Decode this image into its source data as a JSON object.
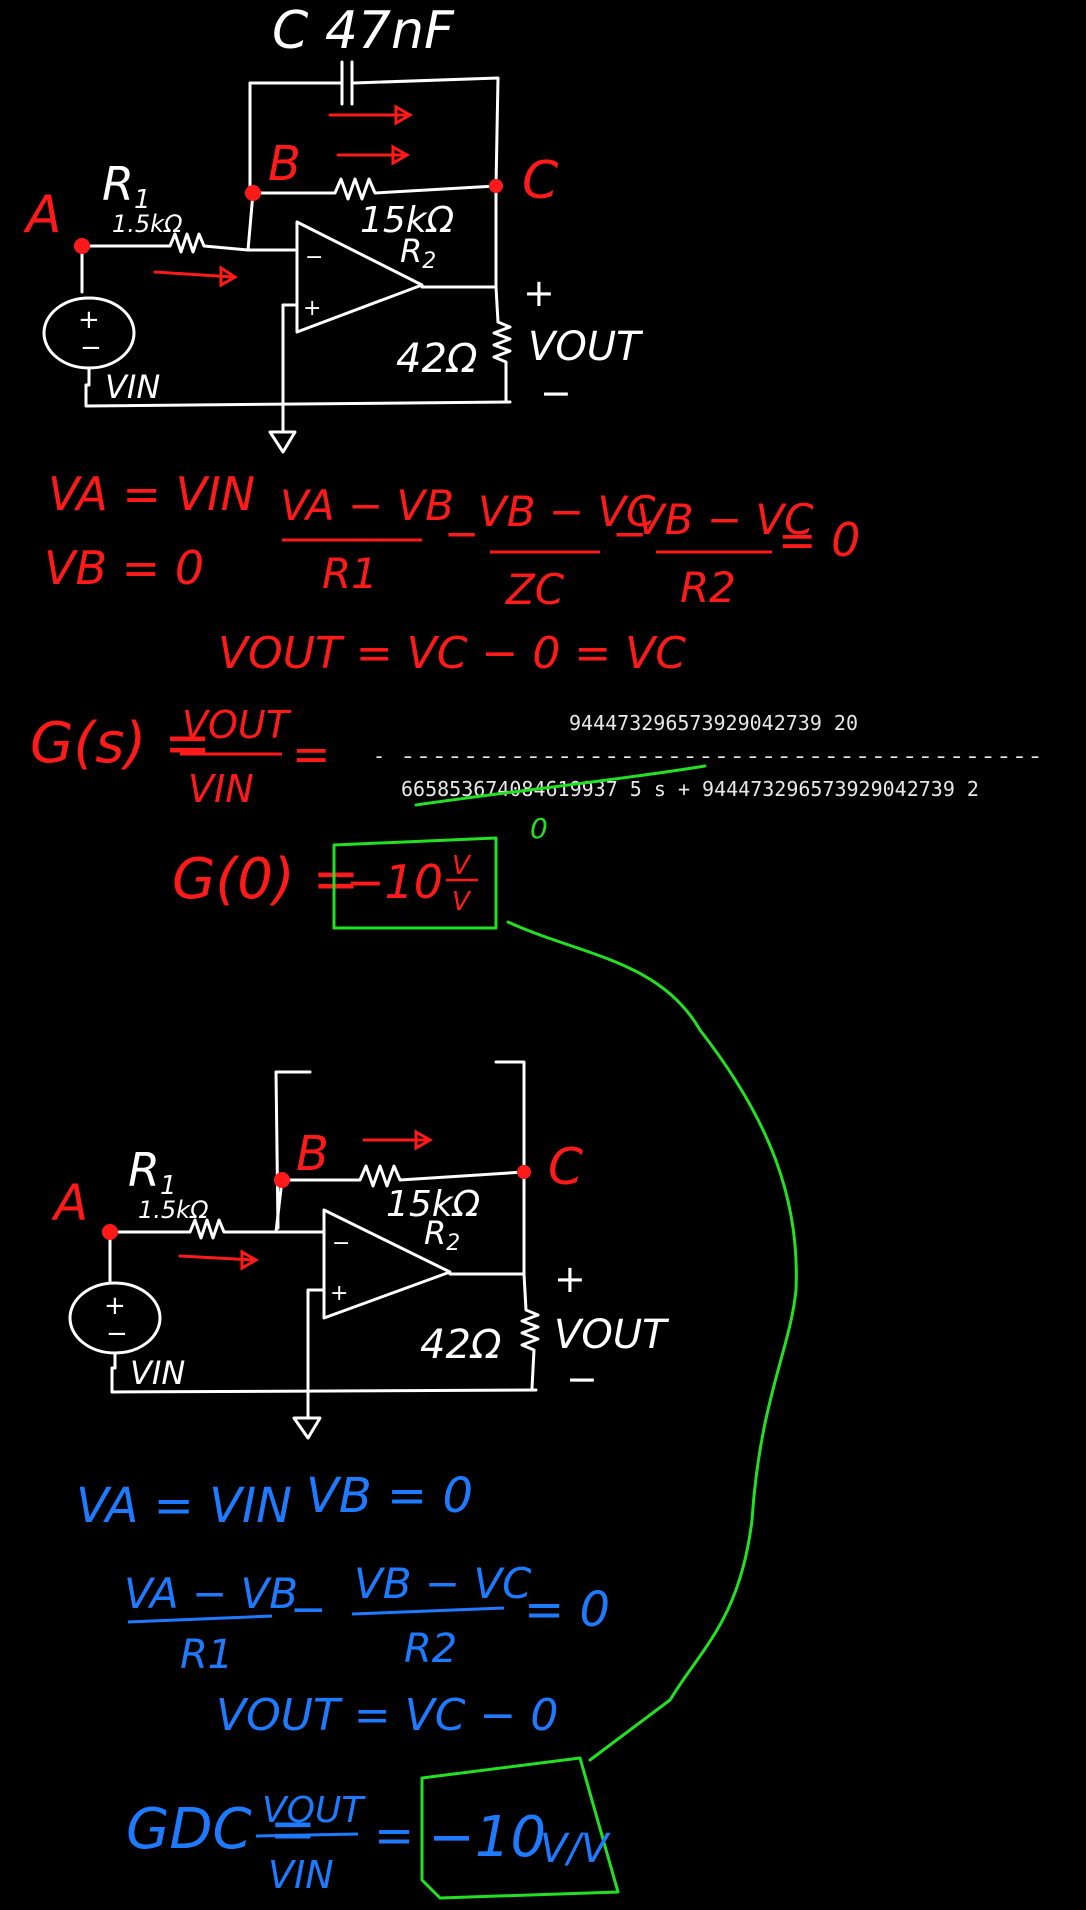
{
  "colors": {
    "background": "#000000",
    "wire": "#ffffff",
    "annotation_red": "#ff1a1a",
    "annotation_green": "#22e022",
    "annotation_blue": "#1e7bff",
    "computer_text": "#e8e8e8"
  },
  "circuit_top": {
    "cap_label": "C 47nF",
    "node_a": "A",
    "node_b": "B",
    "node_c": "C",
    "r1_label": "R",
    "r1_sub": "1",
    "r1_value": "1.5kΩ",
    "r2_value": "15kΩ",
    "r2_label": "R",
    "r2_sub": "2",
    "load_value": "42Ω",
    "vout": "VOUT",
    "vin": "VIN",
    "plus": "+",
    "minus": "−",
    "opamp_minus": "−",
    "opamp_plus": "+"
  },
  "equations_red": {
    "va_eq": "VA = VIN",
    "vb_eq": "VB = 0",
    "kcl_num1": "VA − VB",
    "kcl_den1": "R1",
    "kcl_op1": "−",
    "kcl_num2": "VB − VC",
    "kcl_den2": "ZC",
    "kcl_op2": "−",
    "kcl_num3": "VB − VC",
    "kcl_den3": "R2",
    "kcl_rhs": "= 0",
    "vout_eq": "VOUT = VC − 0 = VC",
    "gs_lhs": "G(s) =",
    "gs_num": "VOUT",
    "gs_den": "VIN",
    "gs_eq": "=",
    "g0_lhs": "G(0) =",
    "g0_value": "−10",
    "g0_unit_num": "V",
    "g0_unit_den": "V"
  },
  "transfer_function": {
    "numerator": "944473296573929042739 20",
    "sign": "-",
    "dashes": "-----------------------------------------",
    "denominator": "665853674084619937 5 s + 944473296573929042739 2",
    "zero_mark": "0"
  },
  "circuit_bottom": {
    "node_a": "A",
    "node_b": "B",
    "node_c": "C",
    "r1_label": "R",
    "r1_sub": "1",
    "r1_value": "1.5kΩ",
    "r2_value": "15kΩ",
    "r2_label": "R",
    "r2_sub": "2",
    "load_value": "42Ω",
    "vout": "VOUT",
    "vin": "VIN",
    "plus": "+",
    "minus": "−",
    "opamp_minus": "−",
    "opamp_plus": "+"
  },
  "equations_blue": {
    "va_eq": "VA = VIN",
    "vb_eq": "VB = 0",
    "kcl_num1": "VA − VB",
    "kcl_den1": "R1",
    "kcl_op": "−",
    "kcl_num2": "VB − VC",
    "kcl_den2": "R2",
    "kcl_rhs": "= 0",
    "vout_eq": "VOUT = VC − 0",
    "gdc_lhs": "GDC =",
    "gdc_num": "VOUT",
    "gdc_den": "VIN",
    "gdc_eq": "=",
    "gdc_value": "−10",
    "gdc_unit": "V/V"
  }
}
